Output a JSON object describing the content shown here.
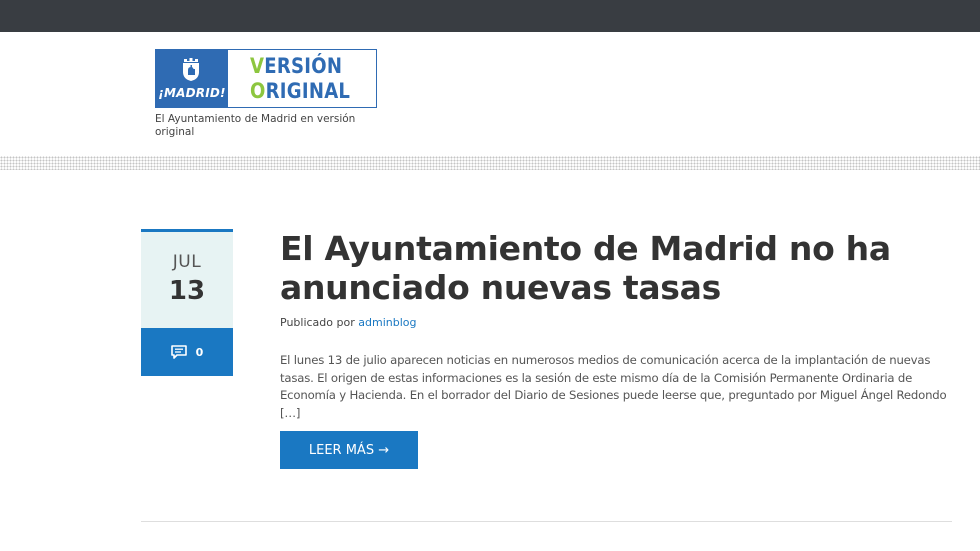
{
  "site": {
    "logo": {
      "city_text": "¡MADRID!",
      "line1_accent": "V",
      "line1_rest": "ERSIÓN",
      "line2_accent": "O",
      "line2_rest": "RIGINAL",
      "icon": "madrid-crest-icon"
    },
    "tagline": "El Ayuntamiento de Madrid en versión original"
  },
  "post": {
    "month": "JUL",
    "day": "13",
    "comment_count": "0",
    "comment_icon": "comment-icon",
    "title": "El Ayuntamiento de Madrid no ha anunciado nuevas tasas",
    "byline_prefix": "Publicado por",
    "author": "adminblog",
    "excerpt": "El lunes 13 de julio aparecen noticias en numerosos medios de comunicación acerca de la implantación de nuevas tasas. El origen de estas informaciones es la sesión de este mismo día de la Comisión Permanente Ordinaria de Economía y Hacienda. En el borrador del Diario de Sesiones puede leerse que, preguntado por Miguel Ángel Redondo […]",
    "read_more": "LEER MÁS →"
  },
  "colors": {
    "topbar": "#393d42",
    "brand_blue": "#2f6bb3",
    "brand_green": "#8dc63f",
    "accent_blue": "#1a78c2",
    "date_bg": "#e7f3f3"
  }
}
